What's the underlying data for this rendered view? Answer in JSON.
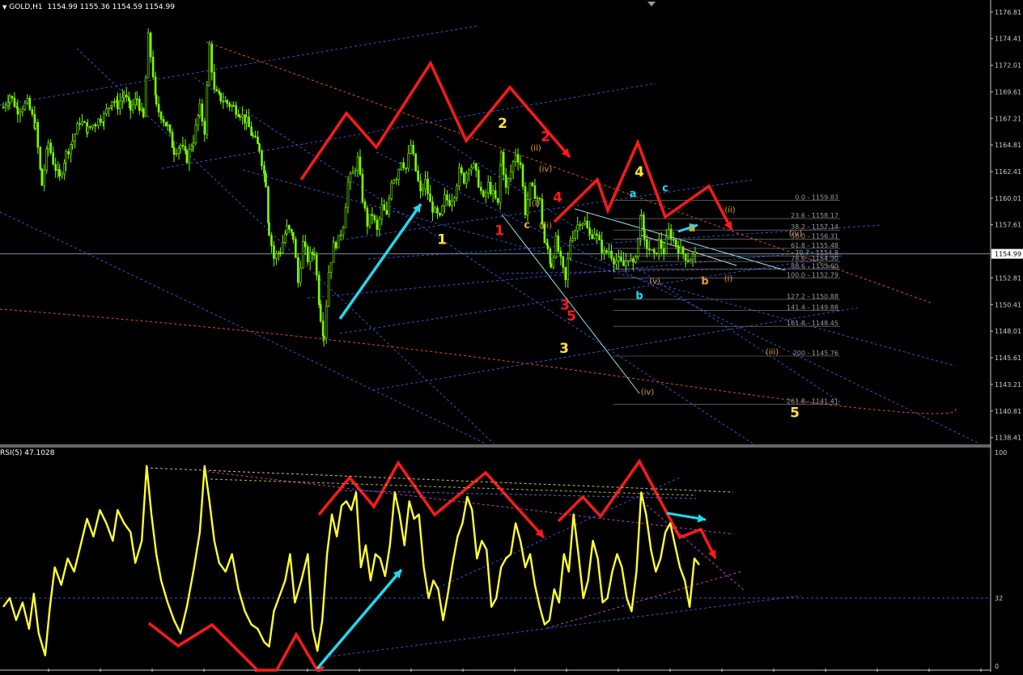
{
  "header": {
    "symbol": "GOLD,H1",
    "ohlc": "1154.99 1155.36 1154.59 1154.99"
  },
  "rsi_header": "RSI(5) 47.1028",
  "colors": {
    "background": "#000000",
    "candle": "#7CFC00",
    "rsi": "#FFFF33",
    "channel": "#3A4FD0",
    "red_arrow": "#FF1A1A",
    "cyan_arrow": "#22D8F0",
    "yellow_label": "#FFE040",
    "orange_label": "#E0A030",
    "fib": "#8A8A8A"
  },
  "chart_data": [
    {
      "type": "candlestick",
      "symbol": "GOLD",
      "timeframe": "H1",
      "ylim": [
        1137.8,
        1177.6
      ],
      "y_ticks": [
        "1176.81",
        "1174.41",
        "1172.01",
        "1169.61",
        "1167.21",
        "1164.81",
        "1162.41",
        "1160.01",
        "1157.61",
        "1154.99",
        "1152.81",
        "1150.41",
        "1148.01",
        "1145.61",
        "1143.21",
        "1140.81",
        "1138.41"
      ],
      "current_price": "1154.99",
      "path": [
        [
          0,
          1168.2
        ],
        [
          8,
          1169.3
        ],
        [
          18,
          1168.0
        ],
        [
          30,
          1168.6
        ],
        [
          40,
          1166.5
        ],
        [
          48,
          1161.2
        ],
        [
          56,
          1165.0
        ],
        [
          62,
          1163.3
        ],
        [
          70,
          1161.8
        ],
        [
          78,
          1164.0
        ],
        [
          86,
          1165.2
        ],
        [
          95,
          1167.0
        ],
        [
          105,
          1166.2
        ],
        [
          115,
          1166.9
        ],
        [
          125,
          1167.4
        ],
        [
          135,
          1168.9
        ],
        [
          142,
          1168.4
        ],
        [
          150,
          1169.4
        ],
        [
          158,
          1168.0
        ],
        [
          166,
          1169.0
        ],
        [
          174,
          1167.2
        ],
        [
          180,
          1174.5
        ],
        [
          186,
          1171.2
        ],
        [
          190,
          1168.2
        ],
        [
          196,
          1167.5
        ],
        [
          204,
          1166.4
        ],
        [
          212,
          1164.3
        ],
        [
          220,
          1164.8
        ],
        [
          228,
          1163.6
        ],
        [
          236,
          1165.3
        ],
        [
          244,
          1168.1
        ],
        [
          250,
          1166.1
        ],
        [
          256,
          1173.8
        ],
        [
          262,
          1169.6
        ],
        [
          270,
          1169.0
        ],
        [
          278,
          1168.6
        ],
        [
          286,
          1168.2
        ],
        [
          294,
          1167.7
        ],
        [
          302,
          1166.9
        ],
        [
          310,
          1165.5
        ],
        [
          318,
          1164.5
        ],
        [
          326,
          1161.4
        ],
        [
          330,
          1157.0
        ],
        [
          336,
          1154.6
        ],
        [
          344,
          1155.3
        ],
        [
          352,
          1157.3
        ],
        [
          360,
          1156.5
        ],
        [
          366,
          1152.4
        ],
        [
          372,
          1155.9
        ],
        [
          378,
          1154.5
        ],
        [
          386,
          1155.2
        ],
        [
          394,
          1149.3
        ],
        [
          398,
          1147.6
        ],
        [
          404,
          1153.4
        ],
        [
          410,
          1155.7
        ],
        [
          416,
          1156.2
        ],
        [
          422,
          1157.7
        ],
        [
          428,
          1161.4
        ],
        [
          434,
          1162.2
        ],
        [
          440,
          1163.5
        ],
        [
          446,
          1160.0
        ],
        [
          452,
          1157.7
        ],
        [
          458,
          1158.6
        ],
        [
          464,
          1157.0
        ],
        [
          470,
          1159.2
        ],
        [
          476,
          1158.3
        ],
        [
          482,
          1161.7
        ],
        [
          488,
          1162.0
        ],
        [
          494,
          1163.5
        ],
        [
          500,
          1162.7
        ],
        [
          506,
          1164.8
        ],
        [
          512,
          1162.5
        ],
        [
          518,
          1160.4
        ],
        [
          524,
          1161.5
        ],
        [
          530,
          1159.5
        ],
        [
          536,
          1158.7
        ],
        [
          542,
          1158.1
        ],
        [
          548,
          1160.0
        ],
        [
          554,
          1159.7
        ],
        [
          560,
          1160.5
        ],
        [
          566,
          1162.4
        ],
        [
          572,
          1161.7
        ],
        [
          578,
          1163.0
        ],
        [
          584,
          1162.8
        ],
        [
          590,
          1161.4
        ],
        [
          596,
          1159.8
        ],
        [
          602,
          1161.2
        ],
        [
          608,
          1160.3
        ],
        [
          614,
          1159.4
        ],
        [
          618,
          1164.1
        ],
        [
          624,
          1160.8
        ],
        [
          630,
          1162.4
        ],
        [
          636,
          1164.1
        ],
        [
          642,
          1163.1
        ],
        [
          648,
          1158.8
        ],
        [
          654,
          1161.0
        ],
        [
          660,
          1160.4
        ],
        [
          666,
          1159.7
        ],
        [
          672,
          1156.0
        ],
        [
          676,
          1155.4
        ],
        [
          680,
          1154.0
        ],
        [
          686,
          1156.2
        ],
        [
          692,
          1154.3
        ],
        [
          698,
          1152.5
        ],
        [
          704,
          1156.3
        ],
        [
          710,
          1157.2
        ],
        [
          716,
          1158.0
        ],
        [
          722,
          1157.8
        ],
        [
          728,
          1156.6
        ],
        [
          734,
          1157.0
        ],
        [
          740,
          1155.9
        ],
        [
          746,
          1155.0
        ],
        [
          752,
          1155.3
        ],
        [
          758,
          1154.5
        ],
        [
          764,
          1154.3
        ],
        [
          770,
          1153.9
        ],
        [
          776,
          1154.8
        ],
        [
          782,
          1153.8
        ],
        [
          788,
          1156.4
        ],
        [
          792,
          1158.9
        ],
        [
          796,
          1155.9
        ],
        [
          802,
          1155.4
        ],
        [
          808,
          1154.7
        ],
        [
          814,
          1156.0
        ],
        [
          820,
          1155.2
        ],
        [
          826,
          1157.0
        ],
        [
          832,
          1156.2
        ],
        [
          838,
          1155.5
        ],
        [
          844,
          1155.0
        ],
        [
          850,
          1154.5
        ],
        [
          856,
          1154.8
        ],
        [
          862,
          1154.99
        ]
      ]
    },
    {
      "type": "line",
      "name": "RSI(5)",
      "value": "47.1028",
      "ylim": [
        0,
        100
      ],
      "y_ticks": [
        "100",
        "32",
        "0"
      ],
      "path": [
        [
          0,
          28
        ],
        [
          8,
          32
        ],
        [
          16,
          22
        ],
        [
          24,
          30
        ],
        [
          32,
          18
        ],
        [
          38,
          34
        ],
        [
          44,
          16
        ],
        [
          52,
          6
        ],
        [
          58,
          28
        ],
        [
          64,
          46
        ],
        [
          72,
          38
        ],
        [
          80,
          50
        ],
        [
          88,
          44
        ],
        [
          96,
          56
        ],
        [
          104,
          68
        ],
        [
          112,
          60
        ],
        [
          120,
          72
        ],
        [
          128,
          66
        ],
        [
          136,
          58
        ],
        [
          142,
          72
        ],
        [
          150,
          66
        ],
        [
          158,
          62
        ],
        [
          164,
          48
        ],
        [
          172,
          58
        ],
        [
          178,
          92
        ],
        [
          184,
          70
        ],
        [
          190,
          52
        ],
        [
          196,
          40
        ],
        [
          204,
          30
        ],
        [
          212,
          22
        ],
        [
          220,
          16
        ],
        [
          228,
          28
        ],
        [
          236,
          44
        ],
        [
          244,
          62
        ],
        [
          250,
          92
        ],
        [
          256,
          76
        ],
        [
          262,
          58
        ],
        [
          268,
          48
        ],
        [
          276,
          44
        ],
        [
          284,
          52
        ],
        [
          292,
          36
        ],
        [
          300,
          26
        ],
        [
          308,
          20
        ],
        [
          316,
          18
        ],
        [
          324,
          12
        ],
        [
          330,
          10
        ],
        [
          336,
          26
        ],
        [
          342,
          32
        ],
        [
          350,
          40
        ],
        [
          356,
          52
        ],
        [
          362,
          30
        ],
        [
          370,
          40
        ],
        [
          378,
          52
        ],
        [
          384,
          18
        ],
        [
          390,
          8
        ],
        [
          396,
          22
        ],
        [
          402,
          52
        ],
        [
          408,
          70
        ],
        [
          414,
          60
        ],
        [
          420,
          74
        ],
        [
          426,
          76
        ],
        [
          432,
          72
        ],
        [
          438,
          80
        ],
        [
          444,
          46
        ],
        [
          450,
          56
        ],
        [
          456,
          40
        ],
        [
          462,
          52
        ],
        [
          468,
          50
        ],
        [
          474,
          42
        ],
        [
          480,
          56
        ],
        [
          486,
          80
        ],
        [
          492,
          70
        ],
        [
          498,
          56
        ],
        [
          504,
          76
        ],
        [
          510,
          68
        ],
        [
          516,
          70
        ],
        [
          522,
          46
        ],
        [
          528,
          32
        ],
        [
          534,
          40
        ],
        [
          540,
          36
        ],
        [
          546,
          22
        ],
        [
          552,
          34
        ],
        [
          558,
          48
        ],
        [
          564,
          60
        ],
        [
          570,
          66
        ],
        [
          576,
          78
        ],
        [
          582,
          72
        ],
        [
          588,
          50
        ],
        [
          594,
          58
        ],
        [
          600,
          54
        ],
        [
          606,
          28
        ],
        [
          612,
          32
        ],
        [
          618,
          46
        ],
        [
          624,
          50
        ],
        [
          630,
          52
        ],
        [
          636,
          66
        ],
        [
          642,
          58
        ],
        [
          648,
          46
        ],
        [
          654,
          52
        ],
        [
          660,
          38
        ],
        [
          666,
          28
        ],
        [
          672,
          20
        ],
        [
          678,
          22
        ],
        [
          684,
          36
        ],
        [
          690,
          30
        ],
        [
          696,
          52
        ],
        [
          702,
          44
        ],
        [
          708,
          70
        ],
        [
          714,
          52
        ],
        [
          720,
          32
        ],
        [
          726,
          40
        ],
        [
          732,
          58
        ],
        [
          738,
          50
        ],
        [
          744,
          30
        ],
        [
          750,
          32
        ],
        [
          756,
          44
        ],
        [
          762,
          52
        ],
        [
          768,
          46
        ],
        [
          774,
          32
        ],
        [
          780,
          26
        ],
        [
          786,
          44
        ],
        [
          792,
          80
        ],
        [
          798,
          70
        ],
        [
          804,
          54
        ],
        [
          810,
          44
        ],
        [
          816,
          50
        ],
        [
          822,
          62
        ],
        [
          828,
          66
        ],
        [
          834,
          56
        ],
        [
          840,
          46
        ],
        [
          846,
          40
        ],
        [
          852,
          28
        ],
        [
          858,
          50
        ],
        [
          864,
          47.1
        ]
      ]
    }
  ],
  "wave_labels": [
    {
      "text": "1",
      "color": "yellow",
      "price": 1156.3
    },
    {
      "text": "2",
      "color": "yellow",
      "price": 1166.8
    },
    {
      "text": "3",
      "color": "yellow",
      "price": 1146.5
    },
    {
      "text": "4",
      "color": "yellow",
      "price": 1162.4
    },
    {
      "text": "5",
      "color": "yellow",
      "price": 1140.7
    },
    {
      "text": "1",
      "color": "red",
      "price": 1157.1
    },
    {
      "text": "2",
      "color": "red",
      "price": 1165.6
    },
    {
      "text": "3",
      "color": "red",
      "price": 1150.4
    },
    {
      "text": "4",
      "color": "red",
      "price": 1160.1
    },
    {
      "text": "5",
      "color": "red",
      "price": 1149.4
    },
    {
      "text": "a",
      "color": "cyan",
      "price": 1160.4
    },
    {
      "text": "b",
      "color": "cyan",
      "price": 1151.2
    },
    {
      "text": "c",
      "color": "cyan",
      "price": 1160.9
    },
    {
      "text": "a",
      "color": "orange",
      "price": 1157.3
    },
    {
      "text": "b",
      "color": "orange",
      "price": 1152.5
    },
    {
      "text": "c",
      "color": "orange",
      "price": 1157.6
    },
    {
      "text": "(i)",
      "color": "orange",
      "price": 1159.6
    },
    {
      "text": "(ii)",
      "color": "orange",
      "price": 1164.6
    },
    {
      "text": "(iii)",
      "color": "orange",
      "price": 1157.6
    },
    {
      "text": "(iv)",
      "color": "orange",
      "price": 1162.7
    },
    {
      "text": "(v)",
      "color": "orange",
      "price": 1152.6
    },
    {
      "text": "(i)",
      "color": "orange",
      "price": 1152.8
    },
    {
      "text": "(ii)",
      "color": "orange",
      "price": 1159.0
    },
    {
      "text": "(iii)",
      "color": "orange",
      "price": 1146.2
    },
    {
      "text": "(iv)",
      "color": "orange",
      "price": 1156.9
    },
    {
      "text": "(iv)",
      "color": "orange",
      "price": 1142.6
    }
  ],
  "fib_levels": [
    {
      "label": "0.0 - 1159.83",
      "price": 1159.83
    },
    {
      "label": "23.6 - 1158.17",
      "price": 1158.17
    },
    {
      "label": "38.2 - 1157.14",
      "price": 1157.14
    },
    {
      "label": "50.0 - 1156.31",
      "price": 1156.31
    },
    {
      "label": "61.8 - 1155.48",
      "price": 1155.48
    },
    {
      "label": "70.7 - 1154.8",
      "price": 1154.8
    },
    {
      "label": "78.6 - 1154.30",
      "price": 1154.3
    },
    {
      "label": "88.6 - 1153.60",
      "price": 1153.6
    },
    {
      "label": "100.0 - 1152.79",
      "price": 1152.79
    },
    {
      "label": "127.2 - 1150.88",
      "price": 1150.88
    },
    {
      "label": "141.4 - 1149.88",
      "price": 1149.88
    },
    {
      "label": "161.8 - 1148.45",
      "price": 1148.45
    },
    {
      "label": "200 - 1145.76",
      "price": 1145.76
    },
    {
      "label": "261.8 - 1141.41",
      "price": 1141.41
    }
  ]
}
